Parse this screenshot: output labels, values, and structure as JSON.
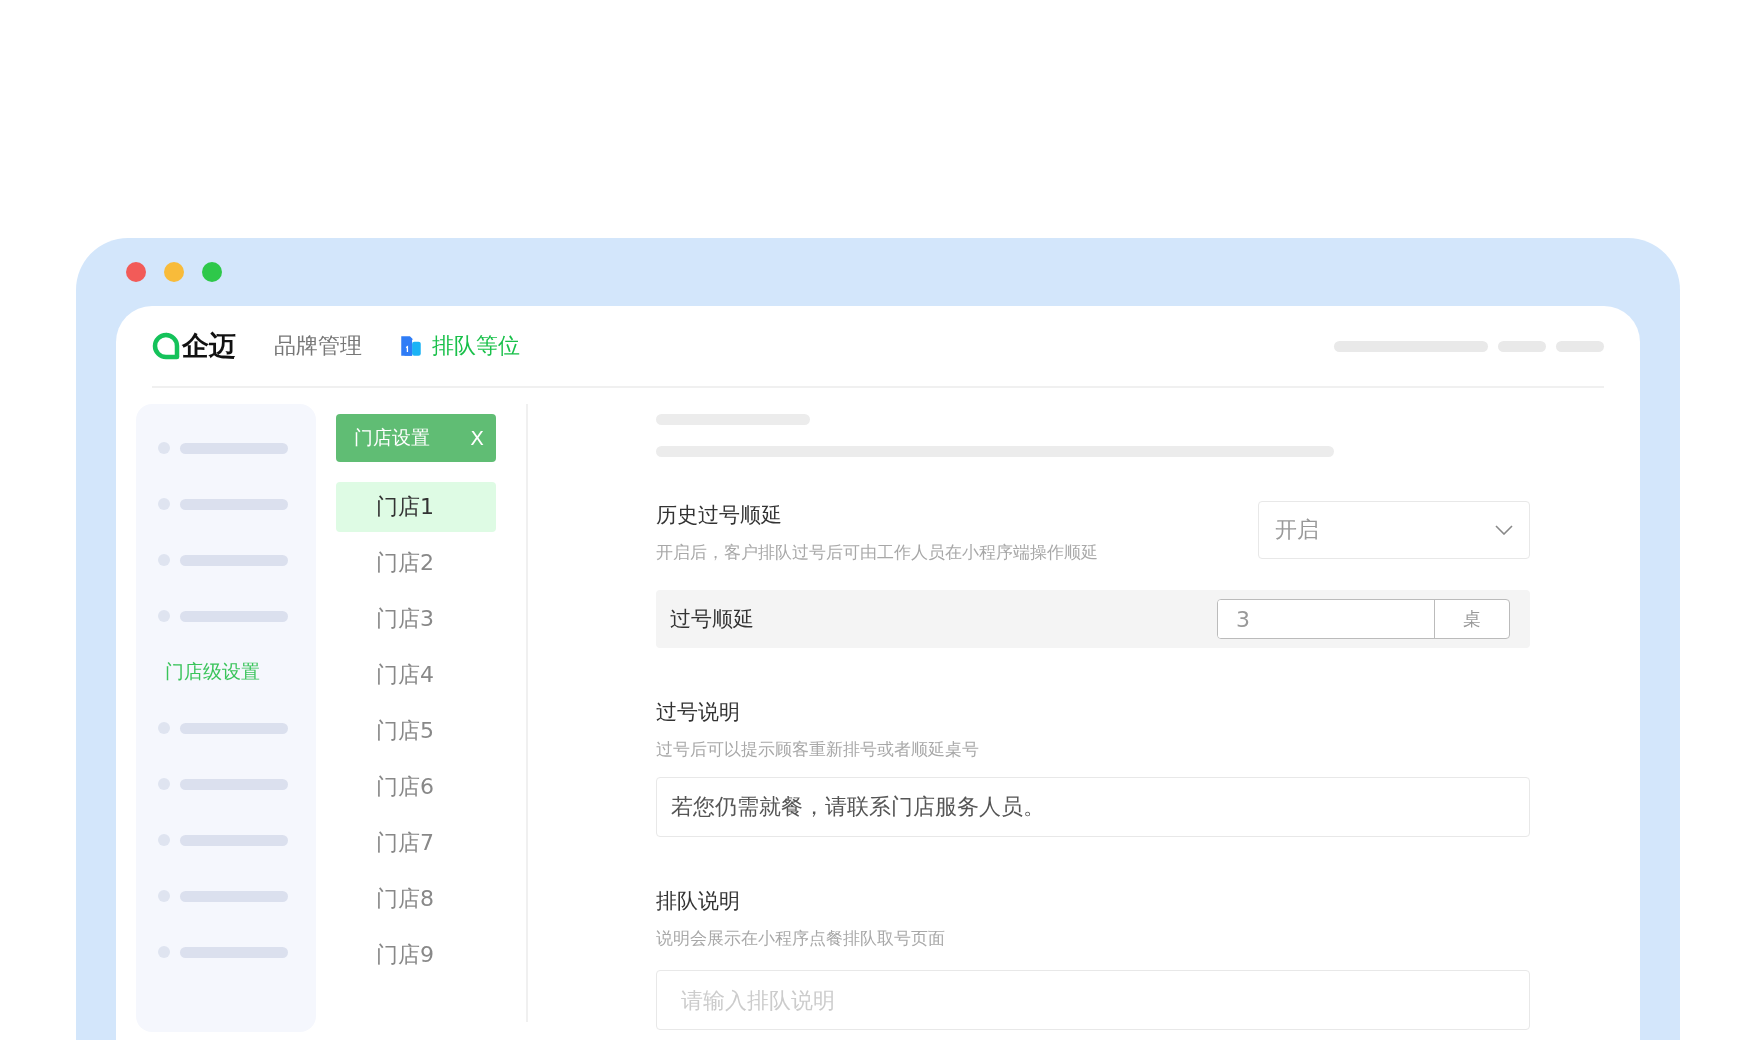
{
  "header": {
    "logo": "企迈",
    "nav": [
      {
        "label": "品牌管理",
        "selected": false,
        "icon": false
      },
      {
        "label": "排队等位",
        "selected": true,
        "icon": true
      }
    ]
  },
  "sidebar": {
    "items": [
      {
        "kind": "placeholder"
      },
      {
        "kind": "placeholder"
      },
      {
        "kind": "placeholder"
      },
      {
        "kind": "placeholder"
      },
      {
        "kind": "link",
        "label": "门店级设置"
      },
      {
        "kind": "placeholder"
      },
      {
        "kind": "placeholder"
      },
      {
        "kind": "placeholder"
      },
      {
        "kind": "placeholder"
      },
      {
        "kind": "placeholder"
      }
    ]
  },
  "store_tab": {
    "label": "门店设置",
    "close": "X"
  },
  "stores": [
    {
      "label": "门店1",
      "selected": true
    },
    {
      "label": "门店2",
      "selected": false
    },
    {
      "label": "门店3",
      "selected": false
    },
    {
      "label": "门店4",
      "selected": false
    },
    {
      "label": "门店5",
      "selected": false
    },
    {
      "label": "门店6",
      "selected": false
    },
    {
      "label": "门店7",
      "selected": false
    },
    {
      "label": "门店8",
      "selected": false
    },
    {
      "label": "门店9",
      "selected": false
    }
  ],
  "settings": {
    "history_delay": {
      "title": "历史过号顺延",
      "description": "开启后，客户排队过号后可由工作人员在小程序端操作顺延",
      "select_value": "开启"
    },
    "delay_row": {
      "label": "过号顺延",
      "value": "3",
      "unit": "桌"
    },
    "sections": [
      {
        "title": "过号说明",
        "description": "过号后可以提示顾客重新排号或者顺延桌号",
        "value": "若您仍需就餐，请联系门店服务人员。"
      },
      {
        "title": "排队说明",
        "description": "说明会展示在小程序点餐排队取号页面",
        "placeholder": "请输入排队说明"
      }
    ]
  }
}
